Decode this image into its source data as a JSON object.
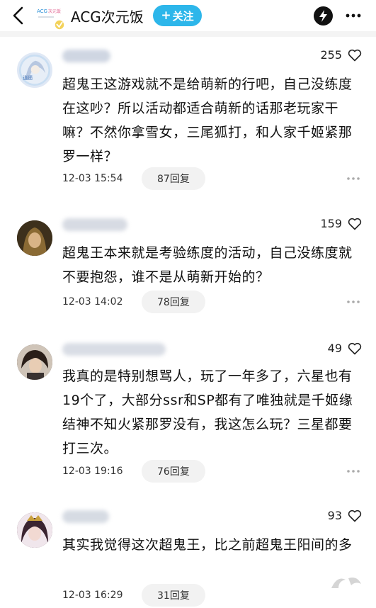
{
  "header": {
    "group_name": "ACG次元饭",
    "follow_label": "关注",
    "follow_plus": "+",
    "brand_color": "#2db6ea"
  },
  "comments": [
    {
      "likes": "255",
      "text": "超鬼王这游戏就不是给萌新的行吧，自己没练度在这吵？所以活动都适合萌新的话那老玩家干嘛？不然你拿雪女，三尾狐打，和人家千姬紧那罗一样？",
      "time": "12-03 15:54",
      "replies": "87回复"
    },
    {
      "likes": "159",
      "text": "超鬼王本来就是考验练度的活动，自己没练度就不要抱怨，谁不是从萌新开始的？",
      "time": "12-03 14:02",
      "replies": "78回复"
    },
    {
      "likes": "49",
      "text": "我真的是特别想骂人，玩了一年多了，六星也有19个了，大部分ssr和SP都有了唯独就是千姬缘结神不知火紧那罗没有，我这怎么玩？三星都要打三次。",
      "time": "12-03 19:16",
      "replies": "76回复"
    },
    {
      "likes": "93",
      "text": "其实我觉得这次超鬼王，比之前超鬼王阳间的多",
      "time": "12-03 16:29",
      "replies": "31回复"
    }
  ],
  "icons": {
    "back": "chevron-left-icon",
    "bolt": "lightning-icon",
    "more": "more-dots-icon",
    "like": "heart-icon",
    "comment_more": "more-dots-icon"
  }
}
